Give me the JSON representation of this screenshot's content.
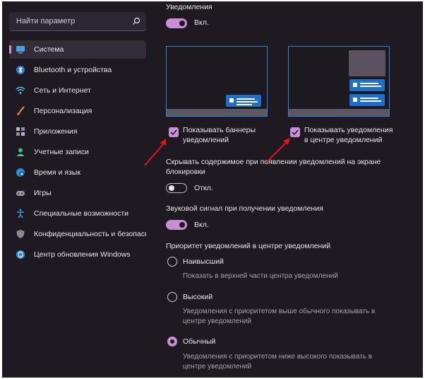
{
  "search": {
    "placeholder": "Найти параметр",
    "icon": "search-icon"
  },
  "sidebar": {
    "items": [
      {
        "label": "Система",
        "icon": "monitor-icon",
        "active": true
      },
      {
        "label": "Bluetooth и устройства",
        "icon": "bluetooth-icon"
      },
      {
        "label": "Сеть и Интернет",
        "icon": "wifi-icon"
      },
      {
        "label": "Персонализация",
        "icon": "brush-icon"
      },
      {
        "label": "Приложения",
        "icon": "apps-icon"
      },
      {
        "label": "Учетные записи",
        "icon": "person-icon"
      },
      {
        "label": "Время и язык",
        "icon": "globe-icon"
      },
      {
        "label": "Игры",
        "icon": "gamepad-icon"
      },
      {
        "label": "Специальные возможности",
        "icon": "accessibility-icon"
      },
      {
        "label": "Конфиденциальность и безопасность",
        "icon": "shield-icon"
      },
      {
        "label": "Центр обновления Windows",
        "icon": "update-icon"
      }
    ]
  },
  "notifications": {
    "title": "Уведомления",
    "toggle_label": "Вкл.",
    "toggle_on": true
  },
  "banners": {
    "line1": "Показывать баннеры",
    "line2": "уведомлений",
    "checked": true
  },
  "center": {
    "line1": "Показывать уведомления",
    "line2": "в центре уведомлений",
    "checked": true
  },
  "lockscreen": {
    "line1": "Скрывать содержимое при появлении уведомлений на экране",
    "line2": "блокировки",
    "toggle_label": "Откл.",
    "toggle_on": false
  },
  "sound": {
    "title": "Звуковой сигнал при получении уведомления",
    "toggle_label": "Вкл.",
    "toggle_on": true
  },
  "priority": {
    "title": "Приоритет уведомлений в центре уведомлений",
    "options": [
      {
        "label": "Наивысший",
        "desc1": "Показать в верхней части центра уведомлений",
        "desc2": "",
        "selected": false
      },
      {
        "label": "Высокий",
        "desc1": "Уведомления с приоритетом выше обычного показывать в",
        "desc2": "центре уведомлений",
        "selected": false
      },
      {
        "label": "Обычный",
        "desc1": "Уведомления с приоритетом ниже высокого показывать в",
        "desc2": "центре уведомлений",
        "selected": true
      }
    ]
  },
  "colors": {
    "accent": "#c98ed6",
    "preview_border": "#2c86d8",
    "arrow": "#e0161d",
    "background": "#1f1a22"
  }
}
